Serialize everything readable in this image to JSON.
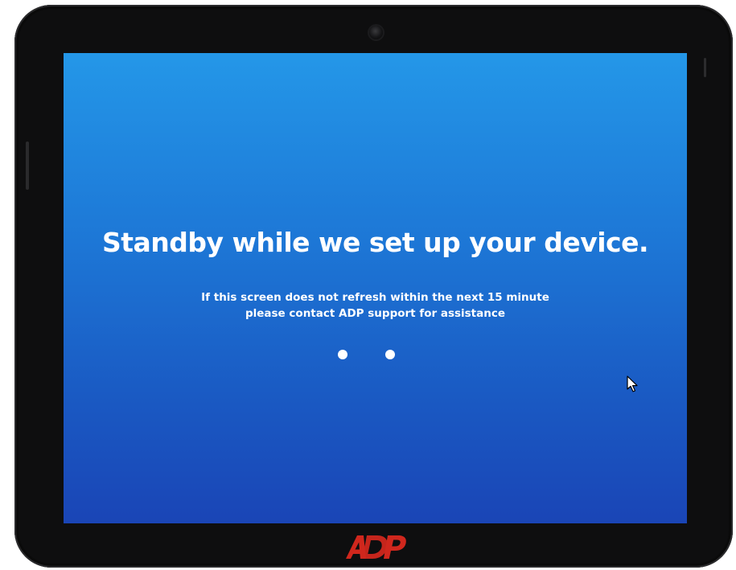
{
  "screen": {
    "headline": "Standby while we set up your device.",
    "message_line1": "If this screen does not refresh within the next 15 minute",
    "message_line2": "please contact ADP support for assistance",
    "loading_dots": 2
  },
  "brand": {
    "logo_text": "ADP",
    "logo_color": "#d0271d"
  },
  "colors": {
    "screen_top": "#2497e8",
    "screen_bottom": "#1a45b6",
    "bezel": "#0e0e0f",
    "text": "#ffffff"
  },
  "icons": [
    "camera-icon",
    "cursor-icon",
    "adp-logo"
  ]
}
